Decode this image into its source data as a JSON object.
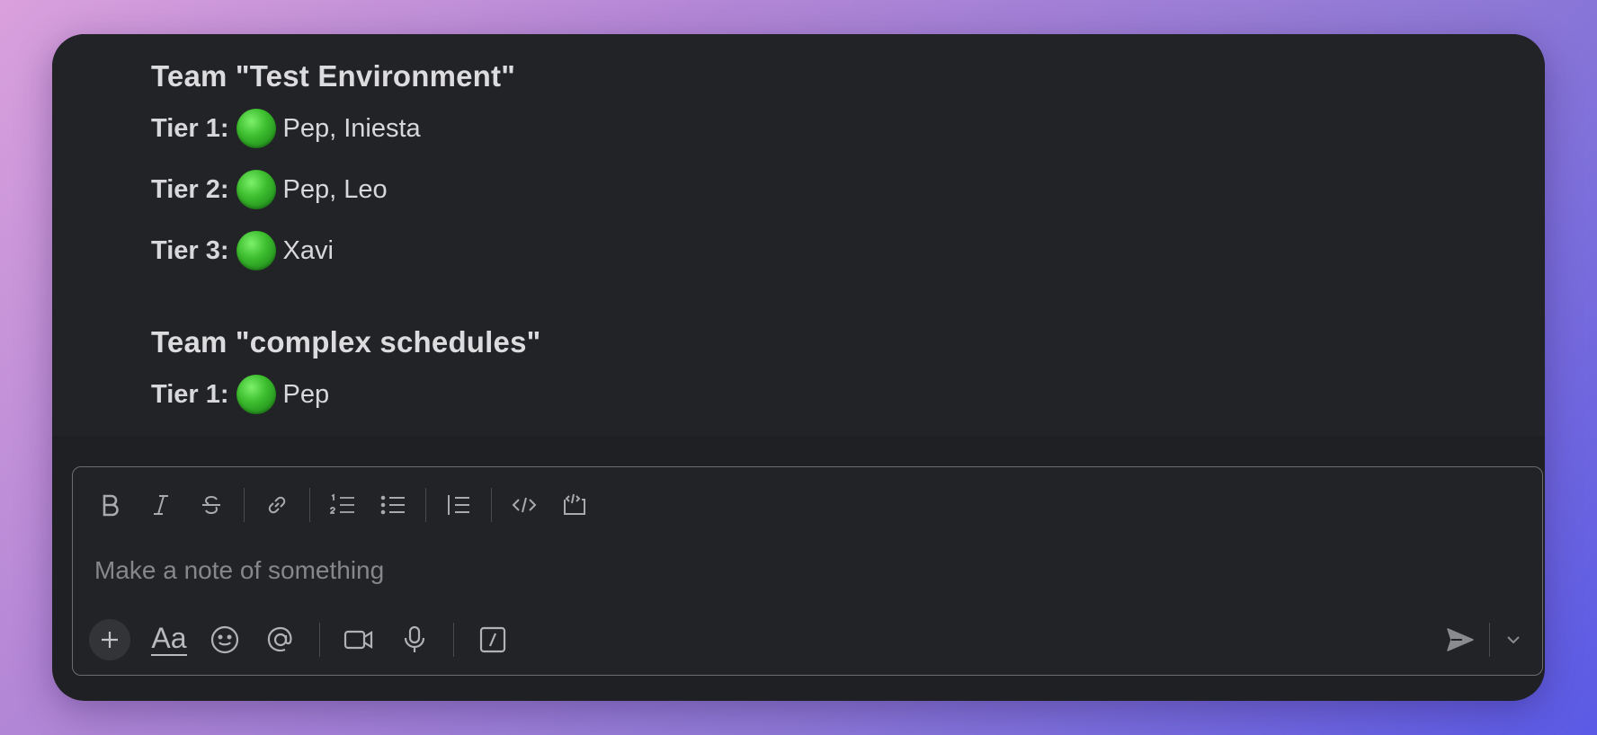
{
  "messages": {
    "teams": [
      {
        "title": "Team \"Test Environment\"",
        "tiers": [
          {
            "label": "Tier 1:",
            "members": "Pep, Iniesta"
          },
          {
            "label": "Tier 2:",
            "members": "Pep, Leo"
          },
          {
            "label": "Tier 3:",
            "members": "Xavi"
          }
        ]
      },
      {
        "title": "Team \"complex schedules\"",
        "tiers": [
          {
            "label": "Tier 1:",
            "members": "Pep"
          }
        ]
      }
    ],
    "status_color": "#3fbf30"
  },
  "composer": {
    "placeholder": "Make a note of something",
    "format_toolbar": [
      "bold-icon",
      "italic-icon",
      "strikethrough-icon",
      "link-icon",
      "ordered-list-icon",
      "bulleted-list-icon",
      "blockquote-icon",
      "code-icon",
      "code-block-icon"
    ],
    "bottom_toolbar": [
      "plus-icon",
      "text-format-icon",
      "emoji-icon",
      "mention-icon",
      "video-icon",
      "microphone-icon",
      "slash-command-icon"
    ],
    "text_format_label": "Aa",
    "send_icon": "send-icon",
    "send_menu_icon": "chevron-down-icon"
  },
  "colors": {
    "window_bg": "#1f2023",
    "message_area_bg": "#222326",
    "text": "#d8d8da",
    "placeholder": "#86878a"
  }
}
